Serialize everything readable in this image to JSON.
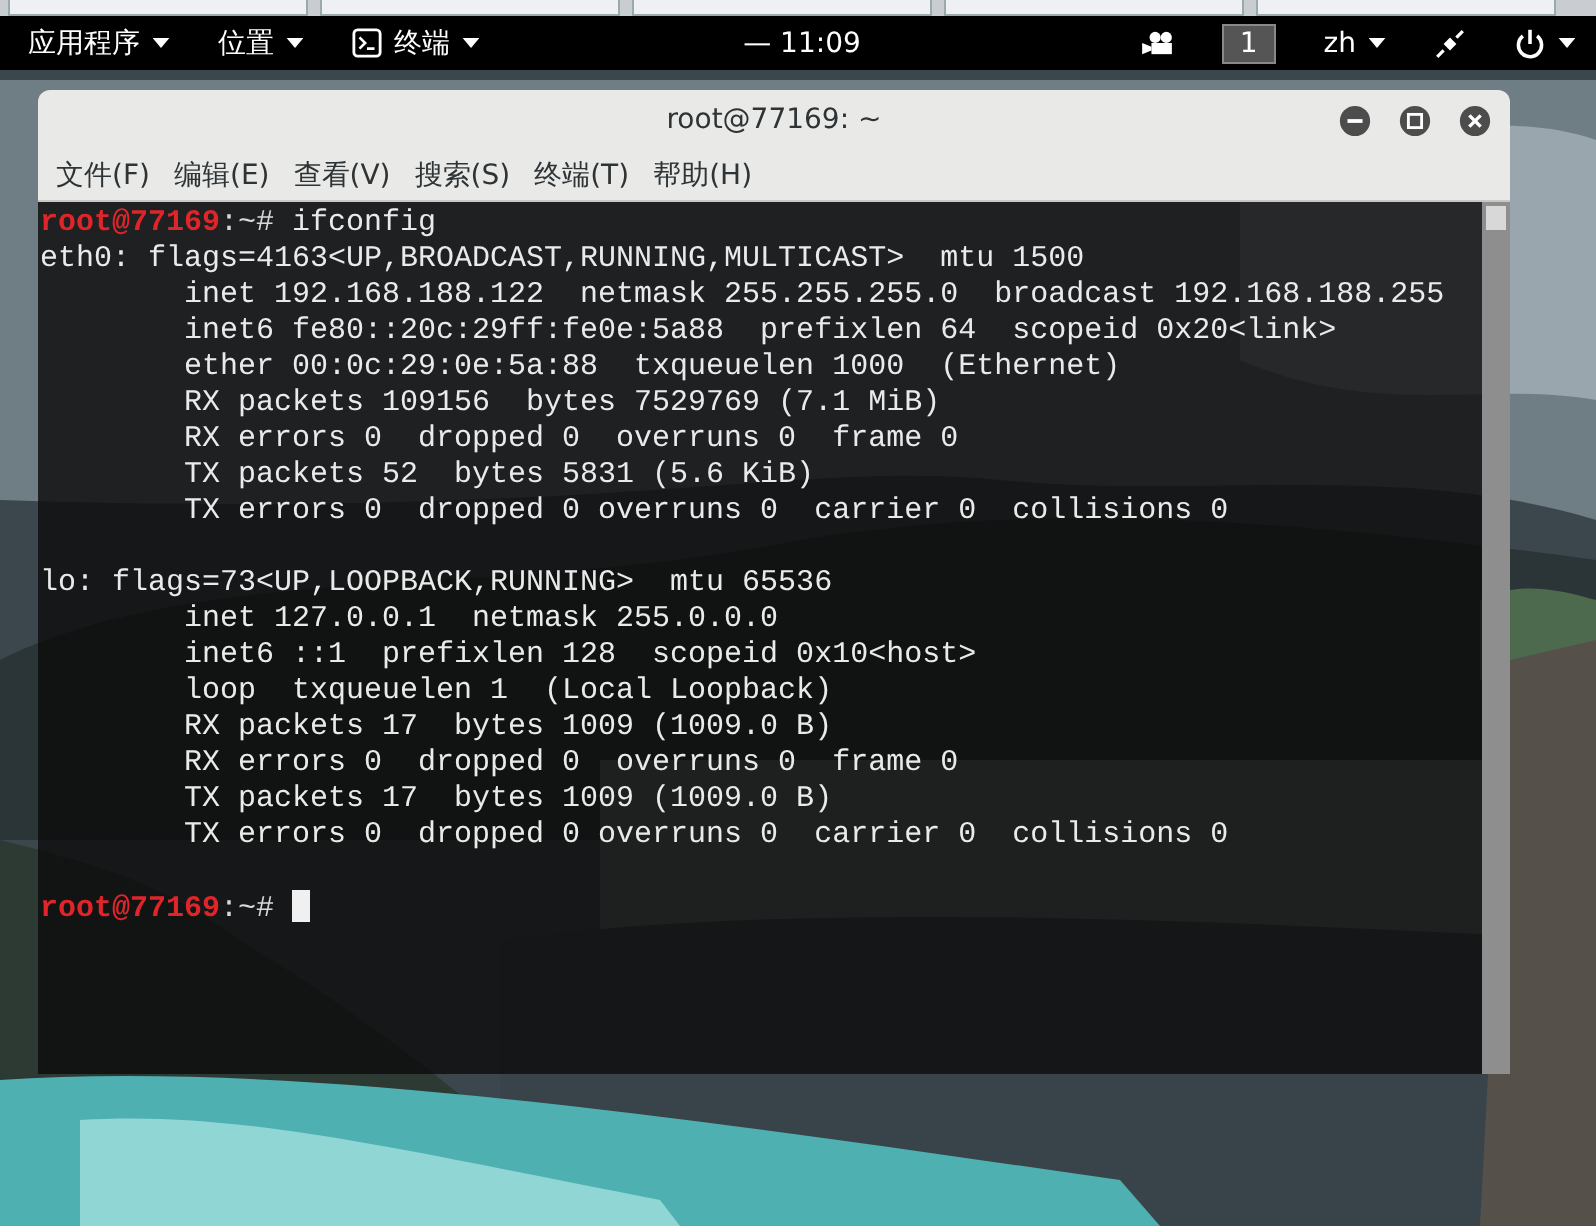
{
  "top_bar": {
    "menus": [
      {
        "label": "应用程序",
        "icon": false
      },
      {
        "label": "位置",
        "icon": false
      },
      {
        "label": "终端",
        "icon": true
      }
    ],
    "clock": "— 11:09",
    "workspace": "1",
    "language": "zh"
  },
  "window": {
    "title": "root@77169: ~",
    "menu": [
      "文件(F)",
      "编辑(E)",
      "查看(V)",
      "搜索(S)",
      "终端(T)",
      "帮助(H)"
    ],
    "terminal": {
      "lines": [
        {
          "kind": "prompt",
          "user": "root@77169",
          "path": ":~# ",
          "command": "ifconfig",
          "cursor": false
        },
        {
          "kind": "output",
          "text": "eth0: flags=4163<UP,BROADCAST,RUNNING,MULTICAST>  mtu 1500"
        },
        {
          "kind": "output",
          "text": "        inet 192.168.188.122  netmask 255.255.255.0  broadcast 192.168.188.255"
        },
        {
          "kind": "output",
          "text": "        inet6 fe80::20c:29ff:fe0e:5a88  prefixlen 64  scopeid 0x20<link>"
        },
        {
          "kind": "output",
          "text": "        ether 00:0c:29:0e:5a:88  txqueuelen 1000  (Ethernet)"
        },
        {
          "kind": "output",
          "text": "        RX packets 109156  bytes 7529769 (7.1 MiB)"
        },
        {
          "kind": "output",
          "text": "        RX errors 0  dropped 0  overruns 0  frame 0"
        },
        {
          "kind": "output",
          "text": "        TX packets 52  bytes 5831 (5.6 KiB)"
        },
        {
          "kind": "output",
          "text": "        TX errors 0  dropped 0 overruns 0  carrier 0  collisions 0"
        },
        {
          "kind": "blank"
        },
        {
          "kind": "output",
          "text": "lo: flags=73<UP,LOOPBACK,RUNNING>  mtu 65536"
        },
        {
          "kind": "output",
          "text": "        inet 127.0.0.1  netmask 255.0.0.0"
        },
        {
          "kind": "output",
          "text": "        inet6 ::1  prefixlen 128  scopeid 0x10<host>"
        },
        {
          "kind": "output",
          "text": "        loop  txqueuelen 1  (Local Loopback)"
        },
        {
          "kind": "output",
          "text": "        RX packets 17  bytes 1009 (1009.0 B)"
        },
        {
          "kind": "output",
          "text": "        RX errors 0  dropped 0  overruns 0  frame 0"
        },
        {
          "kind": "output",
          "text": "        TX packets 17  bytes 1009 (1009.0 B)"
        },
        {
          "kind": "output",
          "text": "        TX errors 0  dropped 0 overruns 0  carrier 0  collisions 0"
        },
        {
          "kind": "blank"
        },
        {
          "kind": "prompt",
          "user": "root@77169",
          "path": ":~# ",
          "cursor": true
        }
      ]
    }
  }
}
